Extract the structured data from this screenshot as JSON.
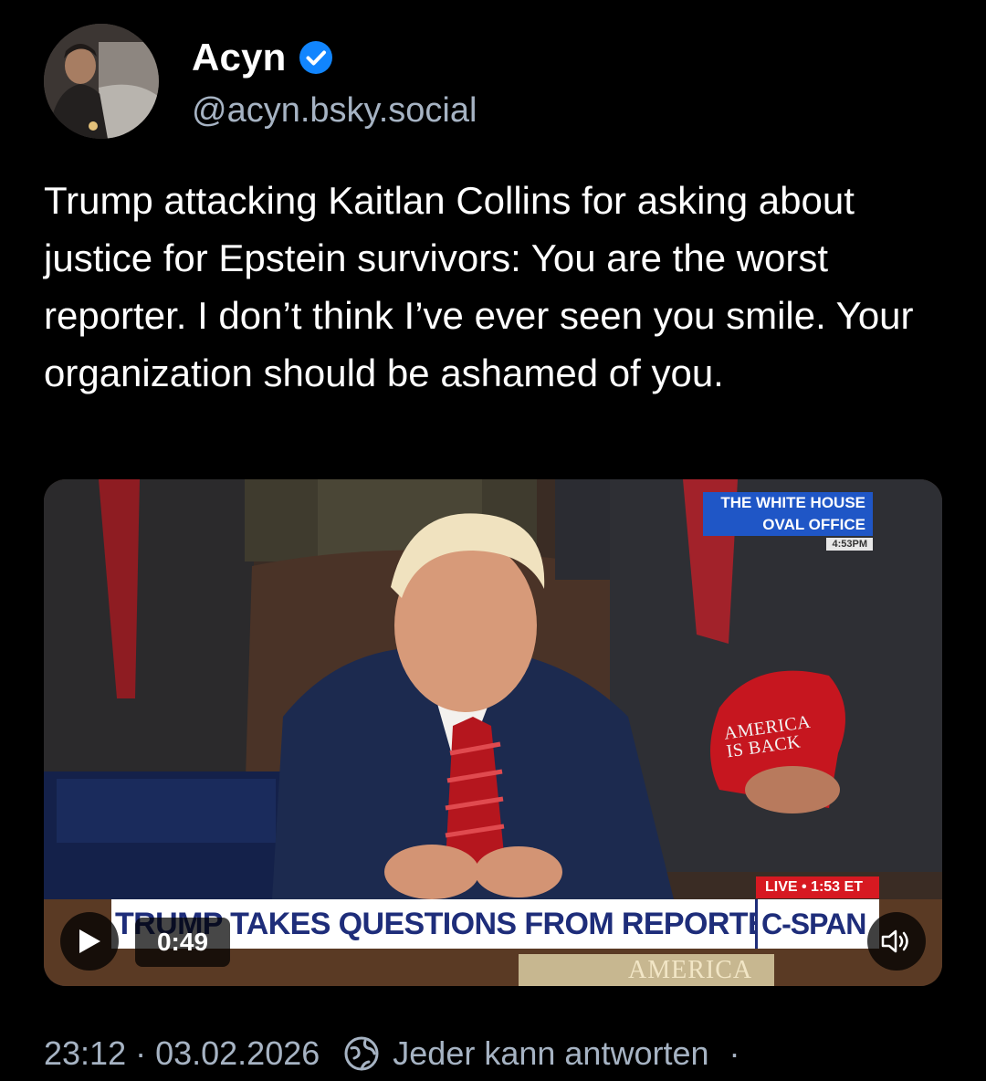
{
  "author": {
    "display_name": "Acyn",
    "handle": "@acyn.bsky.social",
    "verified": true
  },
  "post": {
    "text": "Trump attacking Kaitlan Collins for asking about justice for Epstein survivors: You are the worst reporter. I don’t think I’ve ever seen you smile. Your organization should be ashamed of you."
  },
  "video": {
    "duration": "0:49",
    "overlay": {
      "location_line1": "THE WHITE HOUSE",
      "location_line2": "OVAL OFFICE",
      "clock": "4:53PM",
      "live_label": "LIVE • 1:53 ET",
      "chyron": "TRUMP TAKES QUESTIONS FROM REPORTERS",
      "network": "C-SPAN",
      "hat_line1": "AMERICA",
      "hat_line2": "IS BACK",
      "desk_sign": "AMERICA"
    }
  },
  "meta": {
    "time": "23:12",
    "separator": "·",
    "date": "03.02.2026",
    "reply_setting": "Jeder kann antworten",
    "trailing": "·"
  },
  "colors": {
    "background": "#000000",
    "text_primary": "#ffffff",
    "text_secondary": "#a6b3c3",
    "verified_blue": "#1185fe"
  },
  "icons": {
    "verified": "verified-check-icon",
    "play": "play-icon",
    "mute": "speaker-icon",
    "reply_setting": "globe-icon"
  }
}
